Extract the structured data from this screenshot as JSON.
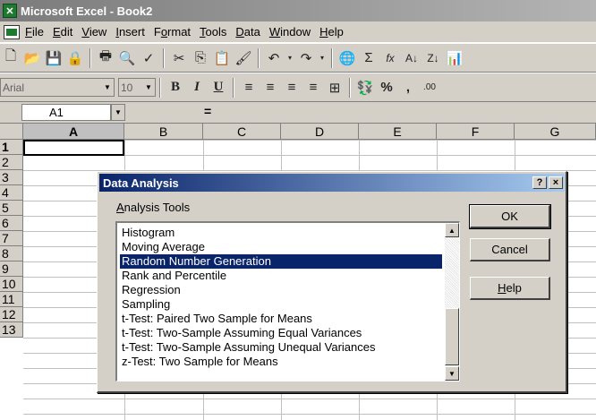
{
  "window": {
    "title": "Microsoft Excel - Book2",
    "app_icon": "excel-icon"
  },
  "menu": [
    {
      "label": "File",
      "mnemonic": "F"
    },
    {
      "label": "Edit",
      "mnemonic": "E"
    },
    {
      "label": "View",
      "mnemonic": "V"
    },
    {
      "label": "Insert",
      "mnemonic": "I"
    },
    {
      "label": "Format",
      "mnemonic": "o"
    },
    {
      "label": "Tools",
      "mnemonic": "T"
    },
    {
      "label": "Data",
      "mnemonic": "D"
    },
    {
      "label": "Window",
      "mnemonic": "W"
    },
    {
      "label": "Help",
      "mnemonic": "H"
    }
  ],
  "toolbar_standard": {
    "icons": [
      "new-icon",
      "open-icon",
      "save-icon",
      "permission-icon",
      "print-icon",
      "print-preview-icon",
      "spelling-icon",
      "cut-icon",
      "copy-icon",
      "paste-icon",
      "format-painter-icon",
      "undo-icon",
      "redo-icon",
      "hyperlink-icon",
      "autosum-icon",
      "insert-function-icon",
      "sort-ascending-icon",
      "sort-descending-icon",
      "chart-wizard-icon"
    ],
    "glyphs": {
      "autosum": "Σ",
      "function": "fx"
    }
  },
  "toolbar_formatting": {
    "font_name": "Arial",
    "font_size": "10",
    "bold": "B",
    "italic": "I",
    "underline": "U",
    "percent": "%",
    "comma": ",",
    "increase_decimal": ".00"
  },
  "formula_bar": {
    "name_box": "A1",
    "equals": "="
  },
  "grid": {
    "columns": [
      "A",
      "B",
      "C",
      "D",
      "E",
      "F",
      "G"
    ],
    "rows": [
      "1",
      "2",
      "3",
      "4",
      "5",
      "6",
      "7",
      "8",
      "9",
      "10",
      "11",
      "12",
      "13"
    ],
    "active_cell": "A1"
  },
  "dialog": {
    "title": "Data Analysis",
    "help_q": "?",
    "close_x": "×",
    "tools_label": "Analysis Tools",
    "tools_label_mnemonic": "A",
    "items": [
      "Histogram",
      "Moving Average",
      "Random Number Generation",
      "Rank and Percentile",
      "Regression",
      "Sampling",
      "t-Test: Paired Two Sample for Means",
      "t-Test: Two-Sample Assuming Equal Variances",
      "t-Test: Two-Sample Assuming Unequal Variances",
      "z-Test: Two Sample for Means"
    ],
    "selected_item": "Random Number Generation",
    "ok_label": "OK",
    "cancel_label": "Cancel",
    "help_label": "Help",
    "help_mnemonic": "H"
  }
}
